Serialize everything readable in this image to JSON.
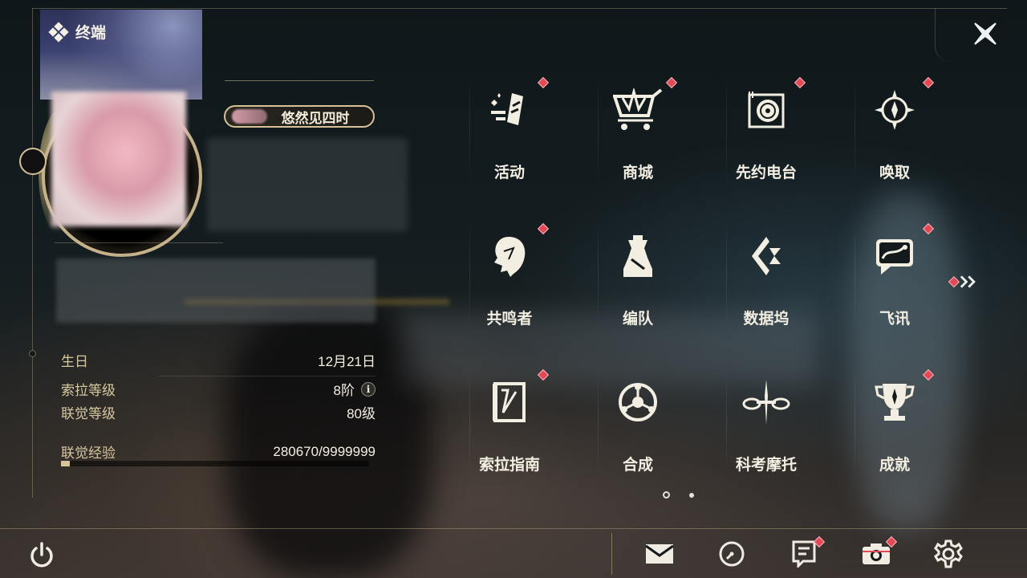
{
  "header": {
    "title": "终端"
  },
  "profile": {
    "nickname": "悠然见四时"
  },
  "stats": [
    {
      "label": "生日",
      "value": "12月21日"
    },
    {
      "label": "索拉等级",
      "value": "8阶",
      "info_icon": "i"
    },
    {
      "label": "联觉等级",
      "value": "80级"
    }
  ],
  "exp": {
    "label": "联觉经验",
    "value": "280670/9999999",
    "fraction": 0.028
  },
  "menu": [
    {
      "label": "活动",
      "icon": "activity-icon",
      "badge": true
    },
    {
      "label": "商城",
      "icon": "shop-cart-icon",
      "badge": true
    },
    {
      "label": "先约电台",
      "icon": "radio-icon",
      "badge": true
    },
    {
      "label": "唤取",
      "icon": "summon-compass-icon",
      "badge": true
    },
    {
      "label": "共鸣者",
      "icon": "resonator-head-icon",
      "badge": true
    },
    {
      "label": "编队",
      "icon": "chess-team-icon",
      "badge": false
    },
    {
      "label": "数据坞",
      "icon": "data-dock-icon",
      "badge": false
    },
    {
      "label": "飞讯",
      "icon": "chat-message-icon",
      "badge": true
    },
    {
      "label": "索拉指南",
      "icon": "guide-book-icon",
      "badge": true
    },
    {
      "label": "合成",
      "icon": "synthesis-icon",
      "badge": false
    },
    {
      "label": "科考摩托",
      "icon": "motorbike-icon",
      "badge": false
    },
    {
      "label": "成就",
      "icon": "trophy-icon",
      "badge": true
    }
  ],
  "pagination": {
    "current": 1,
    "total": 2
  },
  "bottom_bar": [
    {
      "icon": "mail-icon",
      "badge": false
    },
    {
      "icon": "clock-icon",
      "badge": false
    },
    {
      "icon": "notice-icon",
      "badge": true
    },
    {
      "icon": "camera-icon",
      "badge": true
    },
    {
      "icon": "settings-gear-icon",
      "badge": false
    }
  ],
  "colors": {
    "accent": "#d6c199",
    "badge": "#e04a57",
    "text": "#f3eee2"
  }
}
